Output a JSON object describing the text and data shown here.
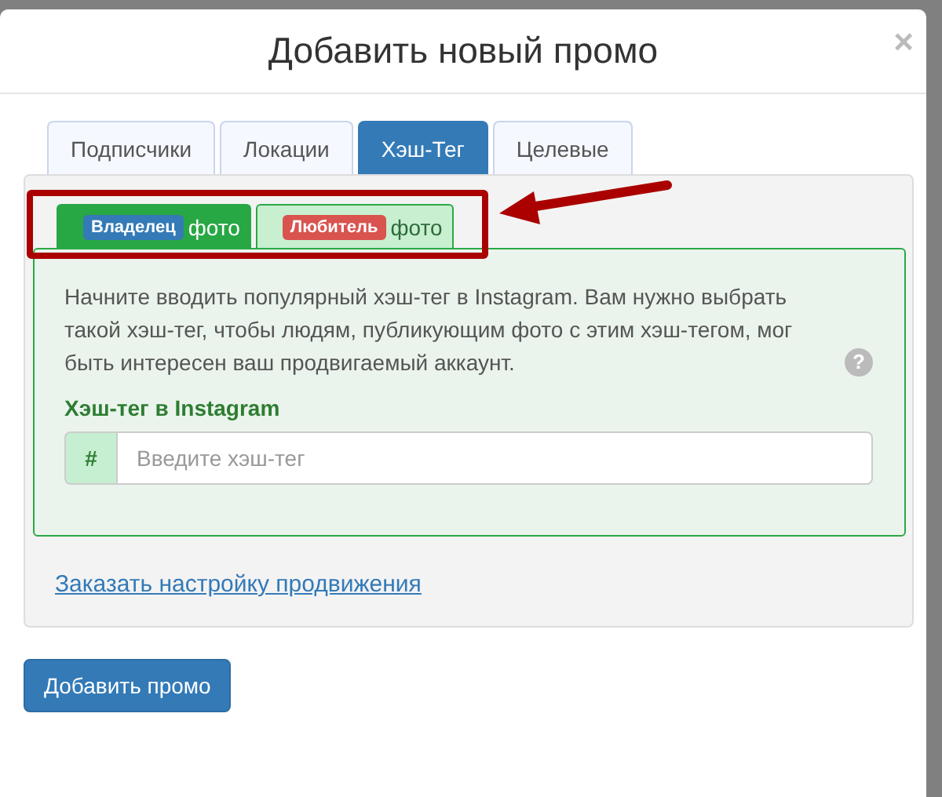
{
  "dialog": {
    "title": "Добавить новый промо",
    "close": "×"
  },
  "tabs": [
    {
      "label": "Подписчики",
      "selected": false
    },
    {
      "label": "Локации",
      "selected": false
    },
    {
      "label": "Хэш-Тег",
      "selected": true
    },
    {
      "label": "Целевые",
      "selected": false
    }
  ],
  "sub_tabs": [
    {
      "badge": "Владелец",
      "color": "#337ab7",
      "label": "фото",
      "selected": true
    },
    {
      "badge": "Любитель",
      "color": "#d9534f",
      "label": "фото",
      "selected": false
    }
  ],
  "description": "Начните вводить популярный хэш-тег в Instagram. Вам нужно выбрать такой хэш-тег, чтобы людям, публикующим фото с этим хэш-тегом, мог быть интересен ваш продвигаемый аккаунт.",
  "help": "?",
  "field": {
    "label": "Хэш-тег в Instagram",
    "addon": "#",
    "placeholder": "Введите хэш-тег"
  },
  "link": "Заказать настройку продвижения",
  "submit_button": "Добавить промо",
  "annotation": {
    "highlight": true
  }
}
